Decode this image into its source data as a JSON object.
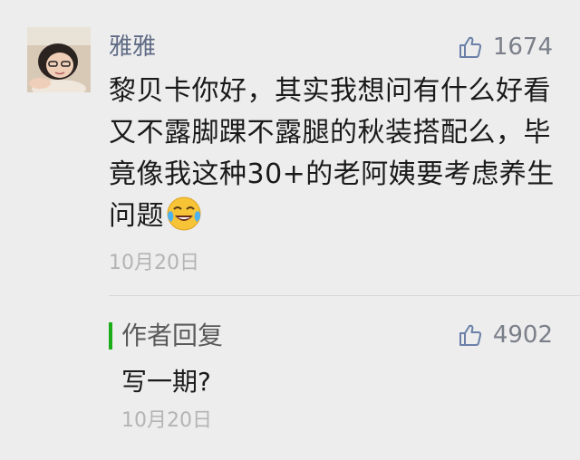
{
  "comment": {
    "username": "雅雅",
    "like_count": "1674",
    "text": "黎贝卡你好，其实我想问有什么好看又不露脚踝不露腿的秋装搭配么，毕竟像我这种30+的老阿姨要考虑养生问题",
    "emoji": "face-with-tears-of-joy",
    "date": "10月20日"
  },
  "reply": {
    "title": "作者回复",
    "like_count": "4902",
    "text": "写一期?",
    "date": "10月20日"
  },
  "colors": {
    "background": "#ededed",
    "username": "#5f6b85",
    "reply_bar": "#1aad19",
    "meta": "#b4b4b4"
  }
}
